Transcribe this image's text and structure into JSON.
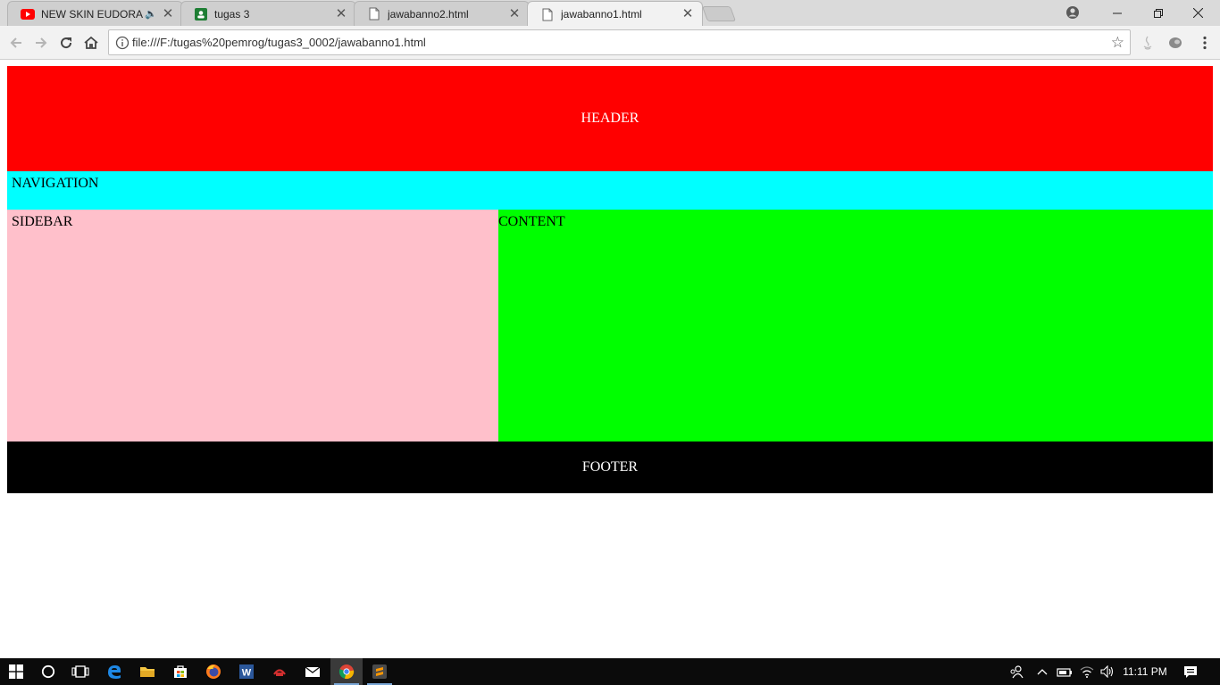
{
  "browser": {
    "tabs": [
      {
        "title": "NEW SKIN EUDORA L",
        "icon": "youtube-icon",
        "audio": true
      },
      {
        "title": "tugas 3",
        "icon": "google-classroom-icon",
        "audio": false
      },
      {
        "title": "jawabanno2.html",
        "icon": "document-icon",
        "audio": false
      },
      {
        "title": "jawabanno1.html",
        "icon": "document-icon",
        "audio": false,
        "active": true
      }
    ],
    "close_glyph": "✕",
    "audio_glyph": "🔈",
    "address": "file:///F:/tugas%20pemrog/tugas3_0002/jawabanno1.html"
  },
  "page": {
    "header": "HEADER",
    "navigation": "NAVIGATION",
    "sidebar": "SIDEBAR",
    "content": "CONTENT",
    "footer": "FOOTER",
    "colors": {
      "header": "#ff0000",
      "navigation": "#00ffff",
      "sidebar": "#ffc0cb",
      "content": "#00ff00",
      "footer": "#000000"
    }
  },
  "taskbar": {
    "time": "11:11 PM",
    "apps": [
      "start-icon",
      "cortana-icon",
      "task-view-icon",
      "edge-icon",
      "file-explorer-icon",
      "store-icon",
      "firefox-icon",
      "word-icon",
      "app-icon",
      "mail-icon",
      "chrome-icon",
      "sublime-icon"
    ]
  }
}
